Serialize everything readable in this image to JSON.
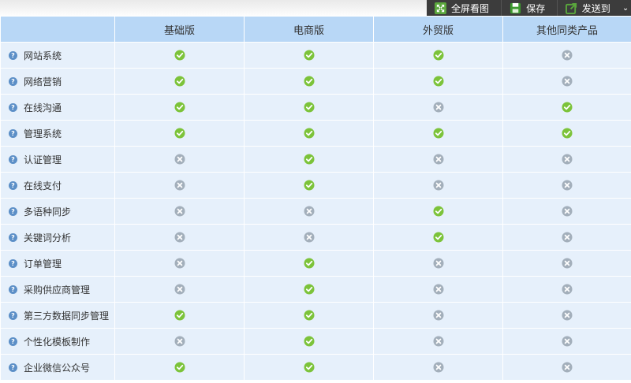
{
  "toolbar": {
    "fullscreen_label": "全屏看图",
    "save_label": "保存",
    "send_label": "发送到",
    "more_glyph": "⌄"
  },
  "table": {
    "columns": [
      "基础版",
      "电商版",
      "外贸版",
      "其他同类产品"
    ],
    "rows": [
      {
        "feature": "网站系统",
        "marks": [
          "yes",
          "yes",
          "yes",
          "no"
        ]
      },
      {
        "feature": "网络营销",
        "marks": [
          "yes",
          "yes",
          "yes",
          "no"
        ]
      },
      {
        "feature": "在线沟通",
        "marks": [
          "yes",
          "yes",
          "no",
          "yes"
        ]
      },
      {
        "feature": "管理系统",
        "marks": [
          "yes",
          "yes",
          "yes",
          "yes"
        ]
      },
      {
        "feature": "认证管理",
        "marks": [
          "no",
          "yes",
          "no",
          "no"
        ]
      },
      {
        "feature": "在线支付",
        "marks": [
          "no",
          "yes",
          "no",
          "no"
        ]
      },
      {
        "feature": "多语种同步",
        "marks": [
          "no",
          "no",
          "yes",
          "no"
        ]
      },
      {
        "feature": "关键词分析",
        "marks": [
          "no",
          "no",
          "yes",
          "no"
        ]
      },
      {
        "feature": "订单管理",
        "marks": [
          "no",
          "yes",
          "no",
          "no"
        ]
      },
      {
        "feature": "采购供应商管理",
        "marks": [
          "no",
          "yes",
          "no",
          "no"
        ]
      },
      {
        "feature": "第三方数据同步管理",
        "marks": [
          "yes",
          "yes",
          "no",
          "no"
        ]
      },
      {
        "feature": "个性化模板制作",
        "marks": [
          "no",
          "yes",
          "no",
          "no"
        ]
      },
      {
        "feature": "企业微信公众号",
        "marks": [
          "yes",
          "yes",
          "no",
          "no"
        ]
      }
    ]
  },
  "icons": {
    "yes": "check-circle-icon",
    "no": "x-circle-icon",
    "help": "help-icon"
  },
  "colors": {
    "yes": "#7cc33a",
    "no": "#a3afbb",
    "header_bg": "#b8d7f6",
    "row_bg": "#e6f0fb",
    "toolbar_bg": "#3c3c3c"
  }
}
